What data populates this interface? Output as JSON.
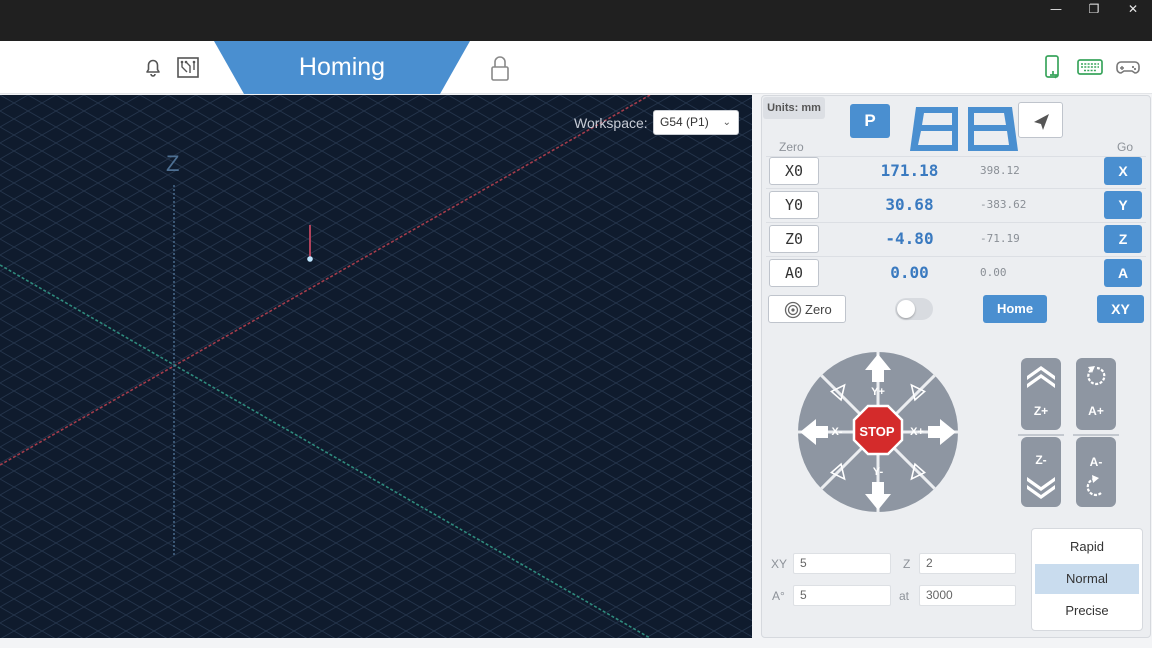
{
  "window": {
    "minimize": "—",
    "maximize": "❐",
    "close": "✕"
  },
  "appbar": {
    "active_tab": "Homing",
    "icons": [
      "bell-icon",
      "circuit-board-icon",
      "lock-icon",
      "phone-icon",
      "keyboard-icon",
      "gamepad-icon"
    ]
  },
  "viewport": {
    "axis_label": "Z",
    "workspace_label": "Workspace:",
    "workspace_value": "G54 (P1)"
  },
  "panel": {
    "units": "Units: mm",
    "probe_button": "P",
    "zero_header": "Zero",
    "go_header": "Go",
    "axes": [
      {
        "zero": "X0",
        "work": "171.18",
        "machine": "398.12",
        "go": "X"
      },
      {
        "zero": "Y0",
        "work": "30.68",
        "machine": "-383.62",
        "go": "Y"
      },
      {
        "zero": "Z0",
        "work": "-4.80",
        "machine": "-71.19",
        "go": "Z"
      },
      {
        "zero": "A0",
        "work": "0.00",
        "machine": "0.00",
        "go": "A"
      }
    ],
    "zero_all": "Zero",
    "home": "Home",
    "xy": "XY",
    "jog": {
      "stop": "STOP",
      "y_plus": "Y+",
      "y_minus": "Y-",
      "x_plus": "X+",
      "x_minus": "X-",
      "z_plus": "Z+",
      "z_minus": "Z-",
      "a_plus": "A+",
      "a_minus": "A-"
    },
    "step": {
      "xy_label": "XY",
      "xy_value": "5",
      "z_label": "Z",
      "z_value": "2",
      "a_label": "A°",
      "a_value": "5",
      "at_label": "at",
      "at_value": "3000"
    },
    "speeds": [
      "Rapid",
      "Normal",
      "Precise"
    ],
    "selected_speed": "Normal"
  },
  "colors": {
    "accent": "#4a8fd0",
    "stop": "#d42b2b",
    "viewport_bg": "#0f1b2d"
  }
}
